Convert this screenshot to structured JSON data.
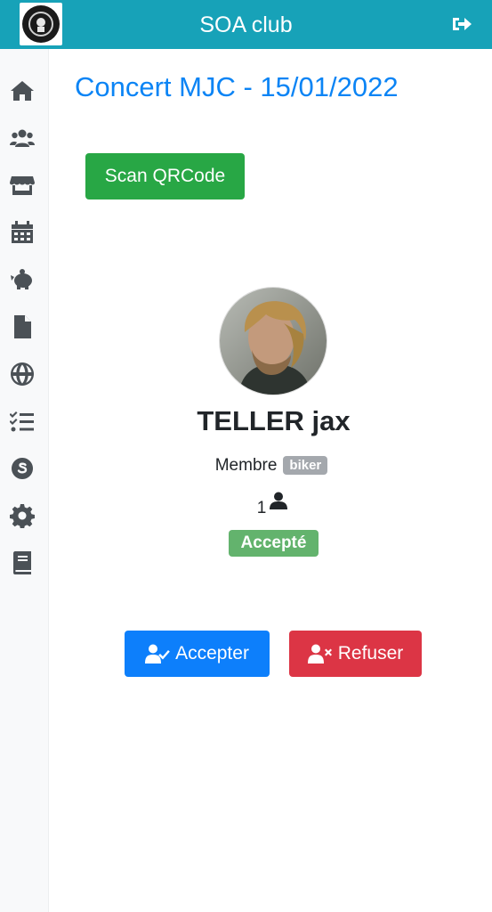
{
  "header": {
    "title": "SOA club",
    "logo_icon": "club-logo",
    "logout_icon": "sign-out-icon"
  },
  "sidebar": {
    "items": [
      {
        "icon": "home-icon"
      },
      {
        "icon": "users-icon"
      },
      {
        "icon": "store-icon"
      },
      {
        "icon": "calendar-icon"
      },
      {
        "icon": "piggy-bank-icon"
      },
      {
        "icon": "file-icon"
      },
      {
        "icon": "globe-icon"
      },
      {
        "icon": "tasks-icon"
      },
      {
        "icon": "skype-icon"
      },
      {
        "icon": "gear-icon"
      },
      {
        "icon": "book-icon"
      }
    ]
  },
  "event": {
    "title": "Concert MJC - 15/01/2022"
  },
  "actions": {
    "scan_label": "Scan QRCode"
  },
  "participant": {
    "name": "TELLER jax",
    "role": "Membre",
    "role_badge": "biker",
    "count": "1",
    "status": "Accepté"
  },
  "decision": {
    "accept_label": "Accepter",
    "refuse_label": "Refuser"
  },
  "colors": {
    "header": "#17a2b8",
    "title": "#0b84f5",
    "scan": "#28a745",
    "accept": "#0d7ffb",
    "refuse": "#dc3545",
    "status": "#63b36d",
    "badge": "#a4a8ad"
  }
}
